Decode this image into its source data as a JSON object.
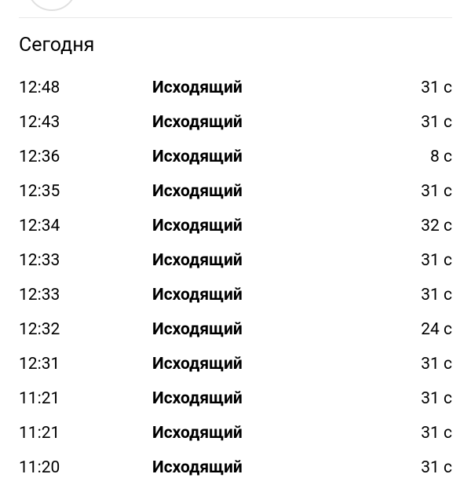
{
  "section_header": "Сегодня",
  "calls": [
    {
      "time": "12:48",
      "type": "Исходящий",
      "duration": "31 с"
    },
    {
      "time": "12:43",
      "type": "Исходящий",
      "duration": "31 с"
    },
    {
      "time": "12:36",
      "type": "Исходящий",
      "duration": "8 с"
    },
    {
      "time": "12:35",
      "type": "Исходящий",
      "duration": "31 с"
    },
    {
      "time": "12:34",
      "type": "Исходящий",
      "duration": "32 с"
    },
    {
      "time": "12:33",
      "type": "Исходящий",
      "duration": "31 с"
    },
    {
      "time": "12:33",
      "type": "Исходящий",
      "duration": "31 с"
    },
    {
      "time": "12:32",
      "type": "Исходящий",
      "duration": "24 с"
    },
    {
      "time": "12:31",
      "type": "Исходящий",
      "duration": "31 с"
    },
    {
      "time": "11:21",
      "type": "Исходящий",
      "duration": "31 с"
    },
    {
      "time": "11:21",
      "type": "Исходящий",
      "duration": "31 с"
    },
    {
      "time": "11:20",
      "type": "Исходящий",
      "duration": "31 с"
    }
  ]
}
